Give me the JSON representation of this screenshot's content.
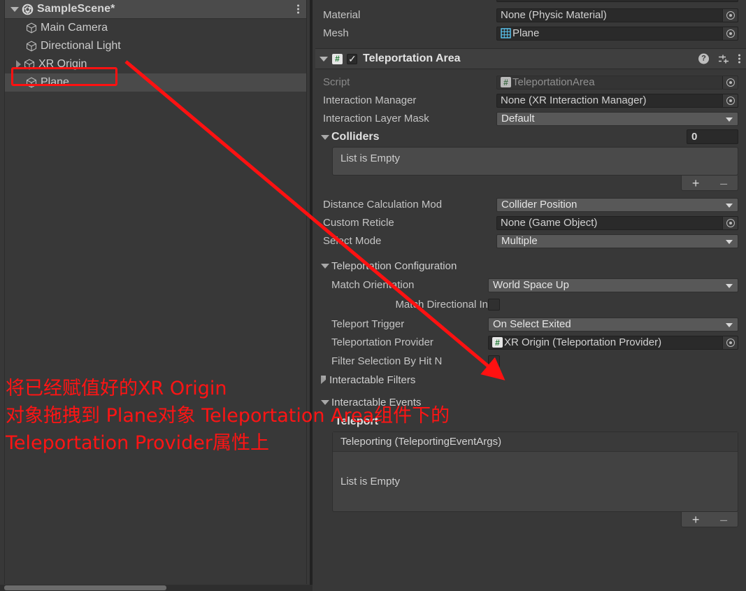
{
  "hierarchy": {
    "scene_name": "SampleScene*",
    "scene_icon": "unity-scene-icon",
    "menu_icon": "kebab-menu-icon",
    "items": [
      {
        "label": "Main Camera",
        "icon": "gameobject-cube-icon",
        "indent": 2,
        "expandable": false,
        "selected": false
      },
      {
        "label": "Directional Light",
        "icon": "gameobject-cube-icon",
        "indent": 2,
        "expandable": false,
        "selected": false
      },
      {
        "label": "XR Origin",
        "icon": "gameobject-cube-icon",
        "indent": 2,
        "expandable": true,
        "selected": false
      },
      {
        "label": "Plane",
        "icon": "gameobject-cube-icon",
        "indent": 2,
        "expandable": false,
        "selected": true
      }
    ]
  },
  "inspector": {
    "mesh_collider_rows": [
      {
        "label": "Material",
        "value": "None (Physic Material)",
        "type": "object"
      },
      {
        "label": "Mesh",
        "value": "Plane",
        "type": "object",
        "badge": "mesh"
      }
    ],
    "component": {
      "title": "Teleportation Area",
      "enabled_checkbox": true,
      "script_icon": "script-badge-icon",
      "help_icon": "help-icon",
      "preset_icon": "preset-settings-icon",
      "menu_icon": "kebab-menu-icon",
      "rows": [
        {
          "label": "Script",
          "value": "TeleportationArea",
          "type": "object",
          "disabled": true,
          "badge": "script"
        },
        {
          "label": "Interaction Manager",
          "value": "None (XR Interaction Manager)",
          "type": "object"
        },
        {
          "label": "Interaction Layer Mask",
          "value": "Default",
          "type": "popup"
        }
      ],
      "colliders": {
        "label": "Colliders",
        "count": "0",
        "empty_text": "List is Empty",
        "add_label": "+",
        "remove_label": "–"
      },
      "rows2": [
        {
          "label": "Distance Calculation Mod",
          "value": "Collider Position",
          "type": "popup"
        },
        {
          "label": "Custom Reticle",
          "value": "None (Game Object)",
          "type": "object"
        },
        {
          "label": "Select Mode",
          "value": "Multiple",
          "type": "popup"
        }
      ],
      "teleport_config": {
        "label": "Teleportation Configuration",
        "rows": [
          {
            "label": "Match Orientation",
            "value": "World Space Up",
            "type": "popup"
          },
          {
            "label": "Match Directional In",
            "value": "",
            "type": "checkbox",
            "checked": false
          },
          {
            "label": "Teleport Trigger",
            "value": "On Select Exited",
            "type": "popup"
          },
          {
            "label": "Teleportation Provider",
            "value": "XR Origin (Teleportation Provider)",
            "type": "object",
            "badge": "script"
          },
          {
            "label": "Filter Selection By Hit N",
            "value": "",
            "type": "checkbox",
            "checked": false
          }
        ]
      },
      "interactable_filters": {
        "label": "Interactable Filters",
        "expanded": false
      },
      "interactable_events": {
        "label": "Interactable Events",
        "group_label": "Teleport",
        "event_name": "Teleporting (TeleportingEventArgs)",
        "empty_text": "List is Empty",
        "add_label": "+",
        "remove_label": "–"
      }
    }
  },
  "annotation": {
    "color": "#ff1414",
    "line1": "将已经赋值好的XR Origin",
    "line2": "对象拖拽到 Plane对象 Teleportation Area组件下的",
    "line3": "Teleportation Provider属性上",
    "highlight_rect_target": "hierarchy-item-plane",
    "arrow_from": "hierarchy-item-plane",
    "arrow_to": "teleportation-provider-field"
  }
}
